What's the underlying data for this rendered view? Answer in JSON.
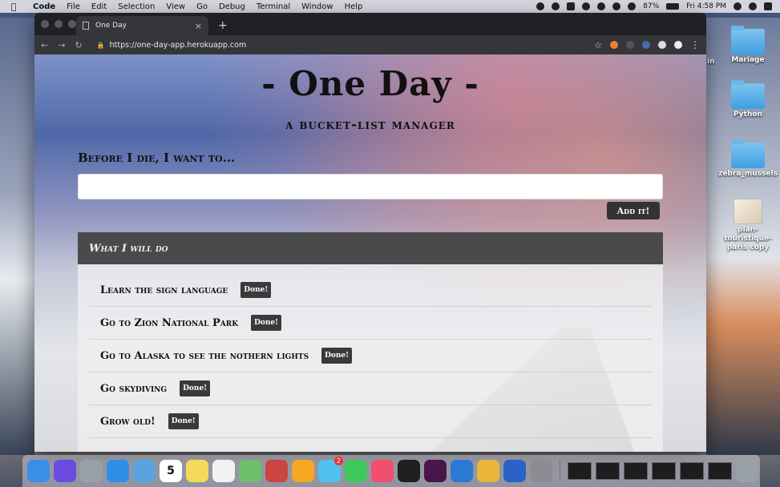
{
  "menubar": {
    "app_name": "Code",
    "items": [
      "File",
      "Edit",
      "Selection",
      "View",
      "Go",
      "Debug",
      "Terminal",
      "Window",
      "Help"
    ],
    "battery": "87%",
    "clock": "Fri 4:58 PM"
  },
  "desktop": {
    "icons": [
      {
        "label": "Mariage",
        "kind": "folder"
      },
      {
        "label": "Python",
        "kind": "folder"
      },
      {
        "label": "zebra_mussels",
        "kind": "folder"
      },
      {
        "label": "plan-touristique-paris copy",
        "kind": "document"
      }
    ],
    "partial_label": "in"
  },
  "browser": {
    "tab_title": "One Day",
    "tab_close": "×",
    "new_tab": "+",
    "url": "https://one-day-app.herokuapp.com"
  },
  "app": {
    "title": "- One Day -",
    "subtitle": "a bucket-list manager",
    "prompt_label": "Before I die, I want to...",
    "input_value": "",
    "add_button": "Add it!",
    "panel_title": "What I will do",
    "done_label": "Done!",
    "items": [
      "Learn the sign language",
      "Go to Zion National Park",
      "Go to Alaska to see the nothern lights",
      "Go skydiving",
      "Grow old!"
    ]
  },
  "dock": {
    "calendar_day": "5",
    "messages_badge": "2",
    "apps": [
      {
        "name": "finder",
        "color": "#3b8ee8"
      },
      {
        "name": "siri",
        "color": "#6a4be0"
      },
      {
        "name": "launchpad",
        "color": "#9aa0a8"
      },
      {
        "name": "safari",
        "color": "#2d8fe8"
      },
      {
        "name": "mail",
        "color": "#5ba3e0"
      },
      {
        "name": "calendar",
        "color": "#ffffff"
      },
      {
        "name": "notes",
        "color": "#f5d95a"
      },
      {
        "name": "reminders",
        "color": "#f2f2f2"
      },
      {
        "name": "maps",
        "color": "#6cc06a"
      },
      {
        "name": "photos-viewer",
        "color": "#c44"
      },
      {
        "name": "photos",
        "color": "#f5a623"
      },
      {
        "name": "messages",
        "color": "#4fc0f0"
      },
      {
        "name": "facetime",
        "color": "#3cc95a"
      },
      {
        "name": "music",
        "color": "#f0506e"
      },
      {
        "name": "terminal",
        "color": "#1f1f1f"
      },
      {
        "name": "slack",
        "color": "#4a154b"
      },
      {
        "name": "vscode",
        "color": "#2a7ad4"
      },
      {
        "name": "chrome",
        "color": "#e9b53a"
      },
      {
        "name": "1password",
        "color": "#2b62c8"
      },
      {
        "name": "system-preferences",
        "color": "#8c8c92"
      }
    ]
  }
}
